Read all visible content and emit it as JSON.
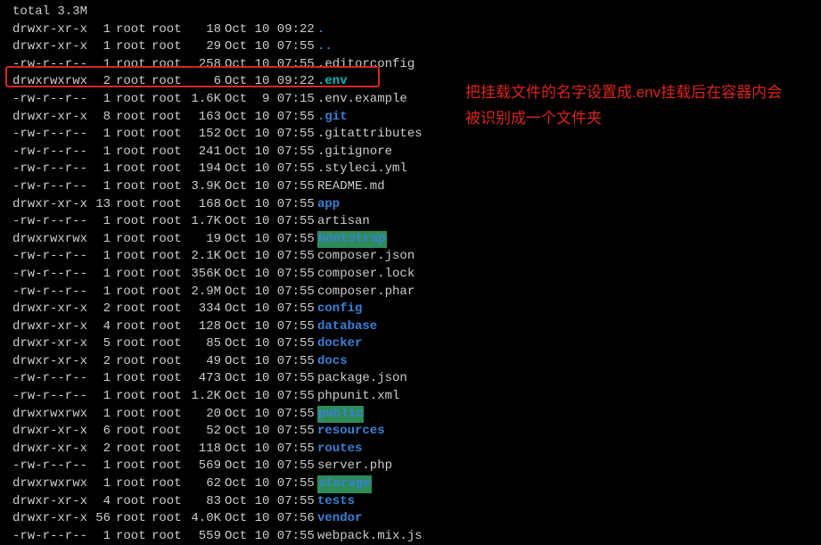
{
  "total_line": "total 3.3M",
  "annotation": "把挂载文件的名字设置成.env挂载后在容器内会被识别成一个文件夹",
  "rows": [
    {
      "perm": "drwxr-xr-x",
      "links": "1",
      "owner": "root",
      "group": "root",
      "size": "18",
      "date": "Oct 10 09:22",
      "name": ".",
      "cls": "c-dir"
    },
    {
      "perm": "drwxr-xr-x",
      "links": "1",
      "owner": "root",
      "group": "root",
      "size": "29",
      "date": "Oct 10 07:55",
      "name": "..",
      "cls": "c-dir"
    },
    {
      "perm": "-rw-r--r--",
      "links": "1",
      "owner": "root",
      "group": "root",
      "size": "258",
      "date": "Oct 10 07:55",
      "name": ".editorconfig",
      "cls": "c-plain"
    },
    {
      "perm": "drwxrwxrwx",
      "links": "2",
      "owner": "root",
      "group": "root",
      "size": "6",
      "date": "Oct 10 09:22",
      "name": ".env",
      "cls": "c-env"
    },
    {
      "perm": "-rw-r--r--",
      "links": "1",
      "owner": "root",
      "group": "root",
      "size": "1.6K",
      "date": "Oct  9 07:15",
      "name": ".env.example",
      "cls": "c-plain"
    },
    {
      "perm": "drwxr-xr-x",
      "links": "8",
      "owner": "root",
      "group": "root",
      "size": "163",
      "date": "Oct 10 07:55",
      "name": ".git",
      "cls": "c-dir"
    },
    {
      "perm": "-rw-r--r--",
      "links": "1",
      "owner": "root",
      "group": "root",
      "size": "152",
      "date": "Oct 10 07:55",
      "name": ".gitattributes",
      "cls": "c-plain"
    },
    {
      "perm": "-rw-r--r--",
      "links": "1",
      "owner": "root",
      "group": "root",
      "size": "241",
      "date": "Oct 10 07:55",
      "name": ".gitignore",
      "cls": "c-plain"
    },
    {
      "perm": "-rw-r--r--",
      "links": "1",
      "owner": "root",
      "group": "root",
      "size": "194",
      "date": "Oct 10 07:55",
      "name": ".styleci.yml",
      "cls": "c-plain"
    },
    {
      "perm": "-rw-r--r--",
      "links": "1",
      "owner": "root",
      "group": "root",
      "size": "3.9K",
      "date": "Oct 10 07:55",
      "name": "README.md",
      "cls": "c-plain"
    },
    {
      "perm": "drwxr-xr-x",
      "links": "13",
      "owner": "root",
      "group": "root",
      "size": "168",
      "date": "Oct 10 07:55",
      "name": "app",
      "cls": "c-dir"
    },
    {
      "perm": "-rw-r--r--",
      "links": "1",
      "owner": "root",
      "group": "root",
      "size": "1.7K",
      "date": "Oct 10 07:55",
      "name": "artisan",
      "cls": "c-plain"
    },
    {
      "perm": "drwxrwxrwx",
      "links": "1",
      "owner": "root",
      "group": "root",
      "size": "19",
      "date": "Oct 10 07:55",
      "name": "bootstrap",
      "cls": "c-777"
    },
    {
      "perm": "-rw-r--r--",
      "links": "1",
      "owner": "root",
      "group": "root",
      "size": "2.1K",
      "date": "Oct 10 07:55",
      "name": "composer.json",
      "cls": "c-plain"
    },
    {
      "perm": "-rw-r--r--",
      "links": "1",
      "owner": "root",
      "group": "root",
      "size": "356K",
      "date": "Oct 10 07:55",
      "name": "composer.lock",
      "cls": "c-plain"
    },
    {
      "perm": "-rw-r--r--",
      "links": "1",
      "owner": "root",
      "group": "root",
      "size": "2.9M",
      "date": "Oct 10 07:55",
      "name": "composer.phar",
      "cls": "c-plain"
    },
    {
      "perm": "drwxr-xr-x",
      "links": "2",
      "owner": "root",
      "group": "root",
      "size": "334",
      "date": "Oct 10 07:55",
      "name": "config",
      "cls": "c-dir"
    },
    {
      "perm": "drwxr-xr-x",
      "links": "4",
      "owner": "root",
      "group": "root",
      "size": "128",
      "date": "Oct 10 07:55",
      "name": "database",
      "cls": "c-dir"
    },
    {
      "perm": "drwxr-xr-x",
      "links": "5",
      "owner": "root",
      "group": "root",
      "size": "85",
      "date": "Oct 10 07:55",
      "name": "docker",
      "cls": "c-dir"
    },
    {
      "perm": "drwxr-xr-x",
      "links": "2",
      "owner": "root",
      "group": "root",
      "size": "49",
      "date": "Oct 10 07:55",
      "name": "docs",
      "cls": "c-dir"
    },
    {
      "perm": "-rw-r--r--",
      "links": "1",
      "owner": "root",
      "group": "root",
      "size": "473",
      "date": "Oct 10 07:55",
      "name": "package.json",
      "cls": "c-plain"
    },
    {
      "perm": "-rw-r--r--",
      "links": "1",
      "owner": "root",
      "group": "root",
      "size": "1.2K",
      "date": "Oct 10 07:55",
      "name": "phpunit.xml",
      "cls": "c-plain"
    },
    {
      "perm": "drwxrwxrwx",
      "links": "1",
      "owner": "root",
      "group": "root",
      "size": "20",
      "date": "Oct 10 07:55",
      "name": "public",
      "cls": "c-777"
    },
    {
      "perm": "drwxr-xr-x",
      "links": "6",
      "owner": "root",
      "group": "root",
      "size": "52",
      "date": "Oct 10 07:55",
      "name": "resources",
      "cls": "c-dir"
    },
    {
      "perm": "drwxr-xr-x",
      "links": "2",
      "owner": "root",
      "group": "root",
      "size": "118",
      "date": "Oct 10 07:55",
      "name": "routes",
      "cls": "c-dir"
    },
    {
      "perm": "-rw-r--r--",
      "links": "1",
      "owner": "root",
      "group": "root",
      "size": "569",
      "date": "Oct 10 07:55",
      "name": "server.php",
      "cls": "c-plain"
    },
    {
      "perm": "drwxrwxrwx",
      "links": "1",
      "owner": "root",
      "group": "root",
      "size": "62",
      "date": "Oct 10 07:55",
      "name": "storage",
      "cls": "c-777"
    },
    {
      "perm": "drwxr-xr-x",
      "links": "4",
      "owner": "root",
      "group": "root",
      "size": "83",
      "date": "Oct 10 07:55",
      "name": "tests",
      "cls": "c-dir"
    },
    {
      "perm": "drwxr-xr-x",
      "links": "56",
      "owner": "root",
      "group": "root",
      "size": "4.0K",
      "date": "Oct 10 07:56",
      "name": "vendor",
      "cls": "c-dir"
    },
    {
      "perm": "-rw-r--r--",
      "links": "1",
      "owner": "root",
      "group": "root",
      "size": "559",
      "date": "Oct 10 07:55",
      "name": "webpack.mix.js",
      "cls": "c-plain"
    }
  ]
}
